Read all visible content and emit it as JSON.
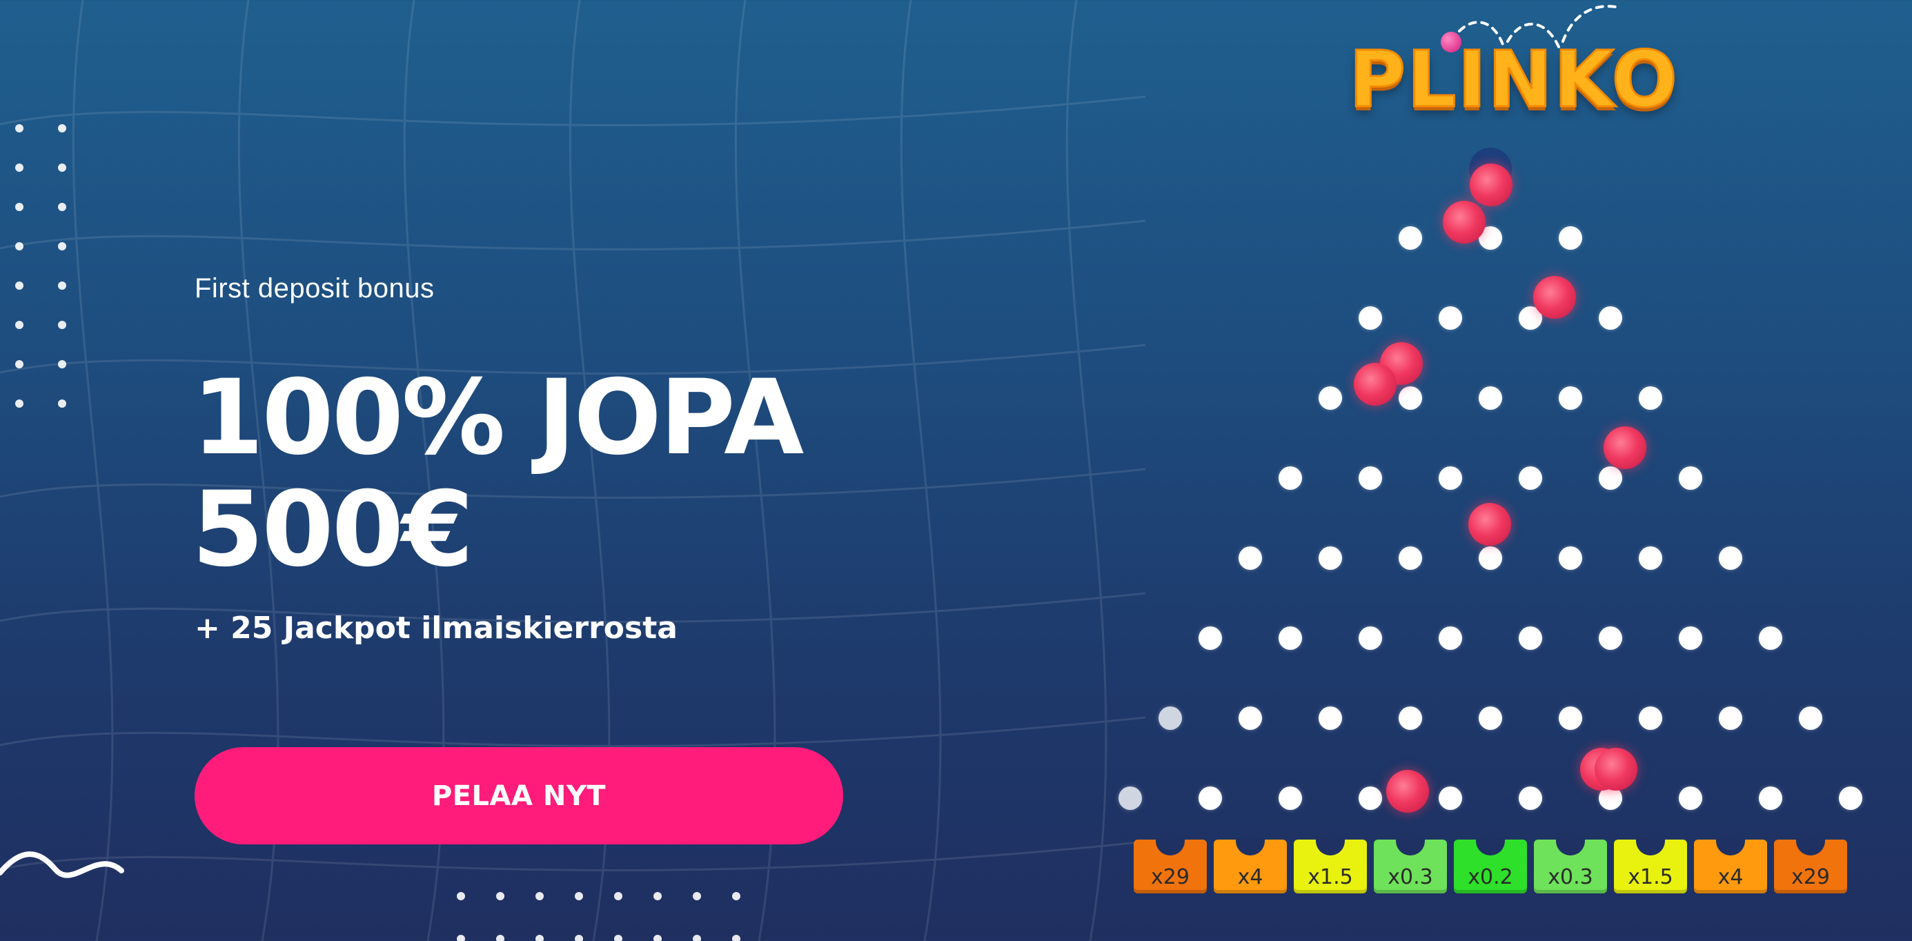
{
  "promo": {
    "eyebrow": "First deposit bonus",
    "headline_line1": "100% JOPA",
    "headline_line2": "500€",
    "subline": "+ 25 Jackpot ilmaiskierrosta",
    "cta_label": "PELAA NYT"
  },
  "game": {
    "logo_text": "PLINKO",
    "multipliers": [
      {
        "label": "x29",
        "color": "#f0730c"
      },
      {
        "label": "x4",
        "color": "#ff9a0e"
      },
      {
        "label": "x1.5",
        "color": "#e9f20e"
      },
      {
        "label": "x0.3",
        "color": "#6ee25a"
      },
      {
        "label": "x0.2",
        "color": "#2fe02a"
      },
      {
        "label": "x0.3",
        "color": "#6ee25a"
      },
      {
        "label": "x1.5",
        "color": "#e9f20e"
      },
      {
        "label": "x4",
        "color": "#ff9a0e"
      },
      {
        "label": "x29",
        "color": "#f0730c"
      }
    ]
  },
  "colors": {
    "accent": "#ff1c7b",
    "ball": "#f0385f",
    "background_top": "#1f5f8e",
    "background_bottom": "#1f2f60"
  }
}
